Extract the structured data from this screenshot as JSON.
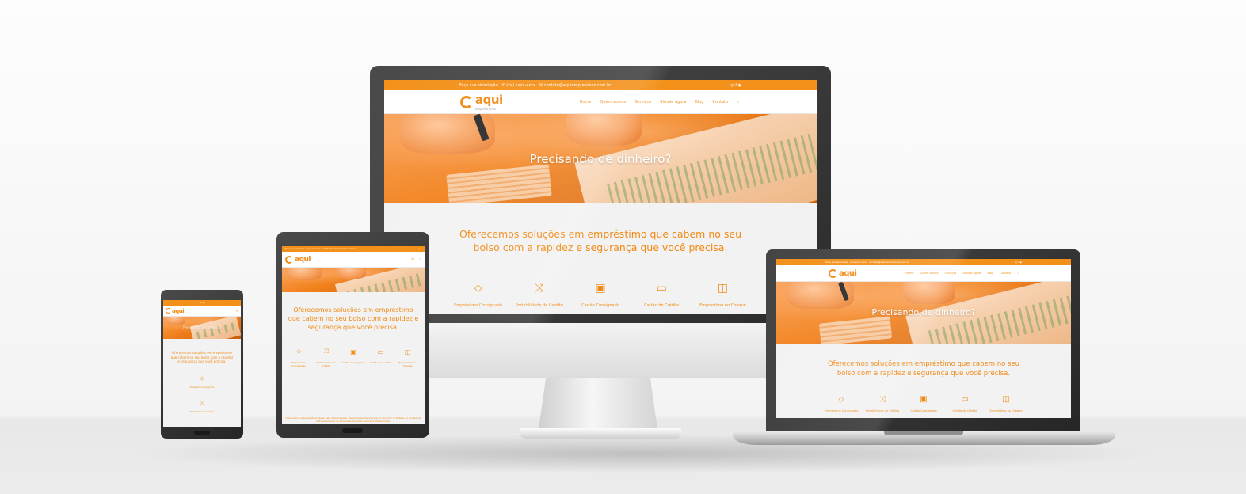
{
  "site": {
    "topbar": {
      "simulacao": "Faça sua simulação",
      "phone": "(xx) xxxx-xxxx",
      "email": "contato@aquiempresimos.com.br",
      "social_icons": [
        "instagram-icon",
        "facebook-icon",
        "whatsapp-icon"
      ]
    },
    "logo": {
      "text": "aqui",
      "sub": "empréstimos"
    },
    "nav": [
      "Home",
      "Quem somos",
      "Serviços",
      "Simule agora",
      "Blog",
      "Contato"
    ],
    "hero_title": "Precisando de dinheiro?",
    "tagline": "Oferecemos soluções em empréstimo que cabem no seu bolso com a rapidez e segurança que você precisa.",
    "services": [
      {
        "label": "Empréstimo Consignado",
        "icon": "money-tag-icon",
        "glyph": "⬦"
      },
      {
        "label": "Portabilidade de Crédito",
        "icon": "shuffle-icon",
        "glyph": "⤨"
      },
      {
        "label": "Cartão Consignado",
        "icon": "id-card-icon",
        "glyph": "▣"
      },
      {
        "label": "Cartão de Crédito",
        "icon": "credit-card-icon",
        "glyph": "▭"
      },
      {
        "label": "Empréstimo no Cheque",
        "icon": "wallet-icon",
        "glyph": "◫"
      }
    ],
    "footer_text": "Oferecemos soluções financeiras para Aposentados, Pensionistas, Servidores do Governo do Estado do Amazonas e Trabalhadores de Empresas Privadas com taxa diferenciada."
  },
  "colors": {
    "brand_orange": "#f39019",
    "text_orange": "#f08a14",
    "page_bg": "#f2f2f2",
    "device_frame": "#2b2b2b"
  }
}
